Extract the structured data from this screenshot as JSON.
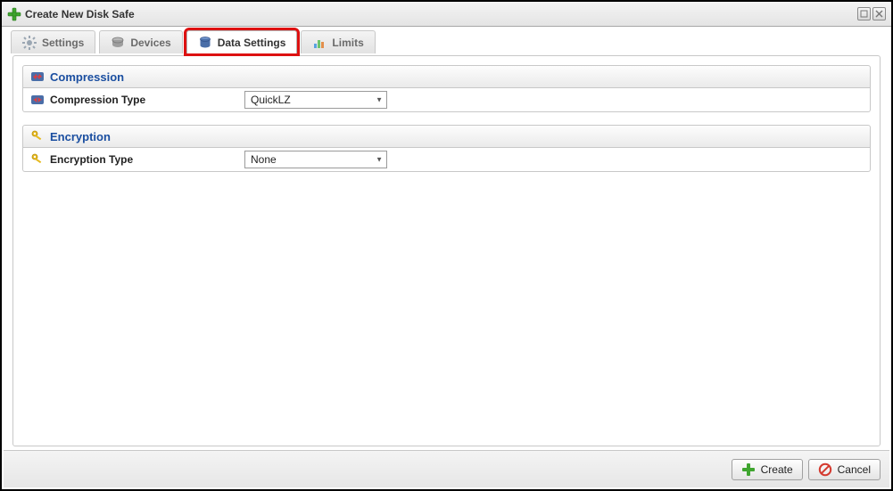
{
  "window": {
    "title": "Create New Disk Safe"
  },
  "tabs": {
    "settings": "Settings",
    "devices": "Devices",
    "data_settings": "Data Settings",
    "limits": "Limits"
  },
  "sections": {
    "compression": {
      "header": "Compression",
      "field_label": "Compression Type",
      "value": "QuickLZ"
    },
    "encryption": {
      "header": "Encryption",
      "field_label": "Encryption Type",
      "value": "None"
    }
  },
  "buttons": {
    "create": "Create",
    "cancel": "Cancel"
  }
}
